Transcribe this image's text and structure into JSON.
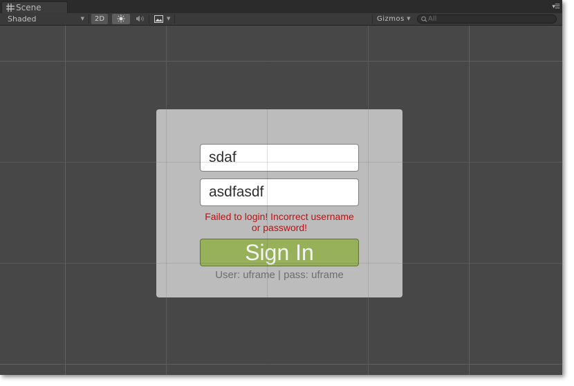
{
  "tab": {
    "label": "Scene"
  },
  "toolbar": {
    "shading_mode": "Shaded",
    "mode_2d": "2D",
    "gizmos_label": "Gizmos",
    "search_placeholder": "All"
  },
  "icons": {
    "scene_tab": "grid-icon",
    "tab_menu": "menu-icon",
    "lighting": "sun-icon",
    "audio": "speaker-icon",
    "effects": "image-icon",
    "search": "search-icon"
  },
  "login": {
    "username_value": "sdaf",
    "password_value": "asdfasdf",
    "error_message": "Failed to login! Incorrect username or password!",
    "sign_in_label": "Sign In",
    "hint": "User: uframe | pass: uframe"
  },
  "colors": {
    "scene_background": "#474747",
    "grid_line": "#5f5f5f",
    "panel": "#cdcdcd",
    "error_text": "#c30e0e",
    "button": "#96b15a"
  }
}
